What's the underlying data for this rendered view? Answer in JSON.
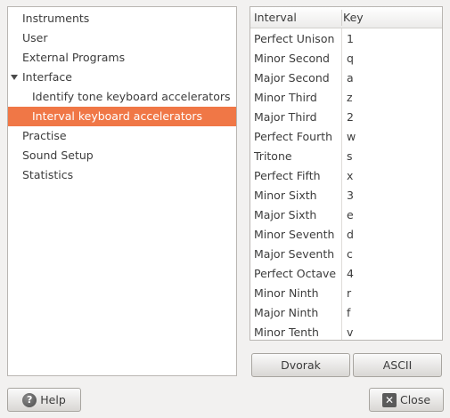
{
  "sidebar": {
    "items": [
      {
        "label": "Instruments"
      },
      {
        "label": "User"
      },
      {
        "label": "External Programs"
      },
      {
        "label": "Interface"
      },
      {
        "label": "Identify tone keyboard accelerators"
      },
      {
        "label": "Interval keyboard accelerators"
      },
      {
        "label": "Practise"
      },
      {
        "label": "Sound Setup"
      },
      {
        "label": "Statistics"
      }
    ],
    "selected_index": 5,
    "accent_color": "#f07746"
  },
  "table": {
    "headers": {
      "interval": "Interval",
      "key": "Key"
    },
    "rows": [
      {
        "interval": "Perfect Unison",
        "key": "1"
      },
      {
        "interval": "Minor Second",
        "key": "q"
      },
      {
        "interval": "Major Second",
        "key": "a"
      },
      {
        "interval": "Minor Third",
        "key": "z"
      },
      {
        "interval": "Major Third",
        "key": "2"
      },
      {
        "interval": "Perfect Fourth",
        "key": "w"
      },
      {
        "interval": "Tritone",
        "key": "s"
      },
      {
        "interval": "Perfect Fifth",
        "key": "x"
      },
      {
        "interval": "Minor Sixth",
        "key": "3"
      },
      {
        "interval": "Major Sixth",
        "key": "e"
      },
      {
        "interval": "Minor Seventh",
        "key": "d"
      },
      {
        "interval": "Major Seventh",
        "key": "c"
      },
      {
        "interval": "Perfect Octave",
        "key": "4"
      },
      {
        "interval": "Minor Ninth",
        "key": "r"
      },
      {
        "interval": "Major Ninth",
        "key": "f"
      },
      {
        "interval": "Minor Tenth",
        "key": "v"
      }
    ]
  },
  "buttons": {
    "dvorak": "Dvorak",
    "ascii": "ASCII",
    "help": "Help",
    "close": "Close"
  },
  "icons": {
    "help": "help-icon",
    "close": "close-icon",
    "expander": "triangle-down-icon"
  }
}
